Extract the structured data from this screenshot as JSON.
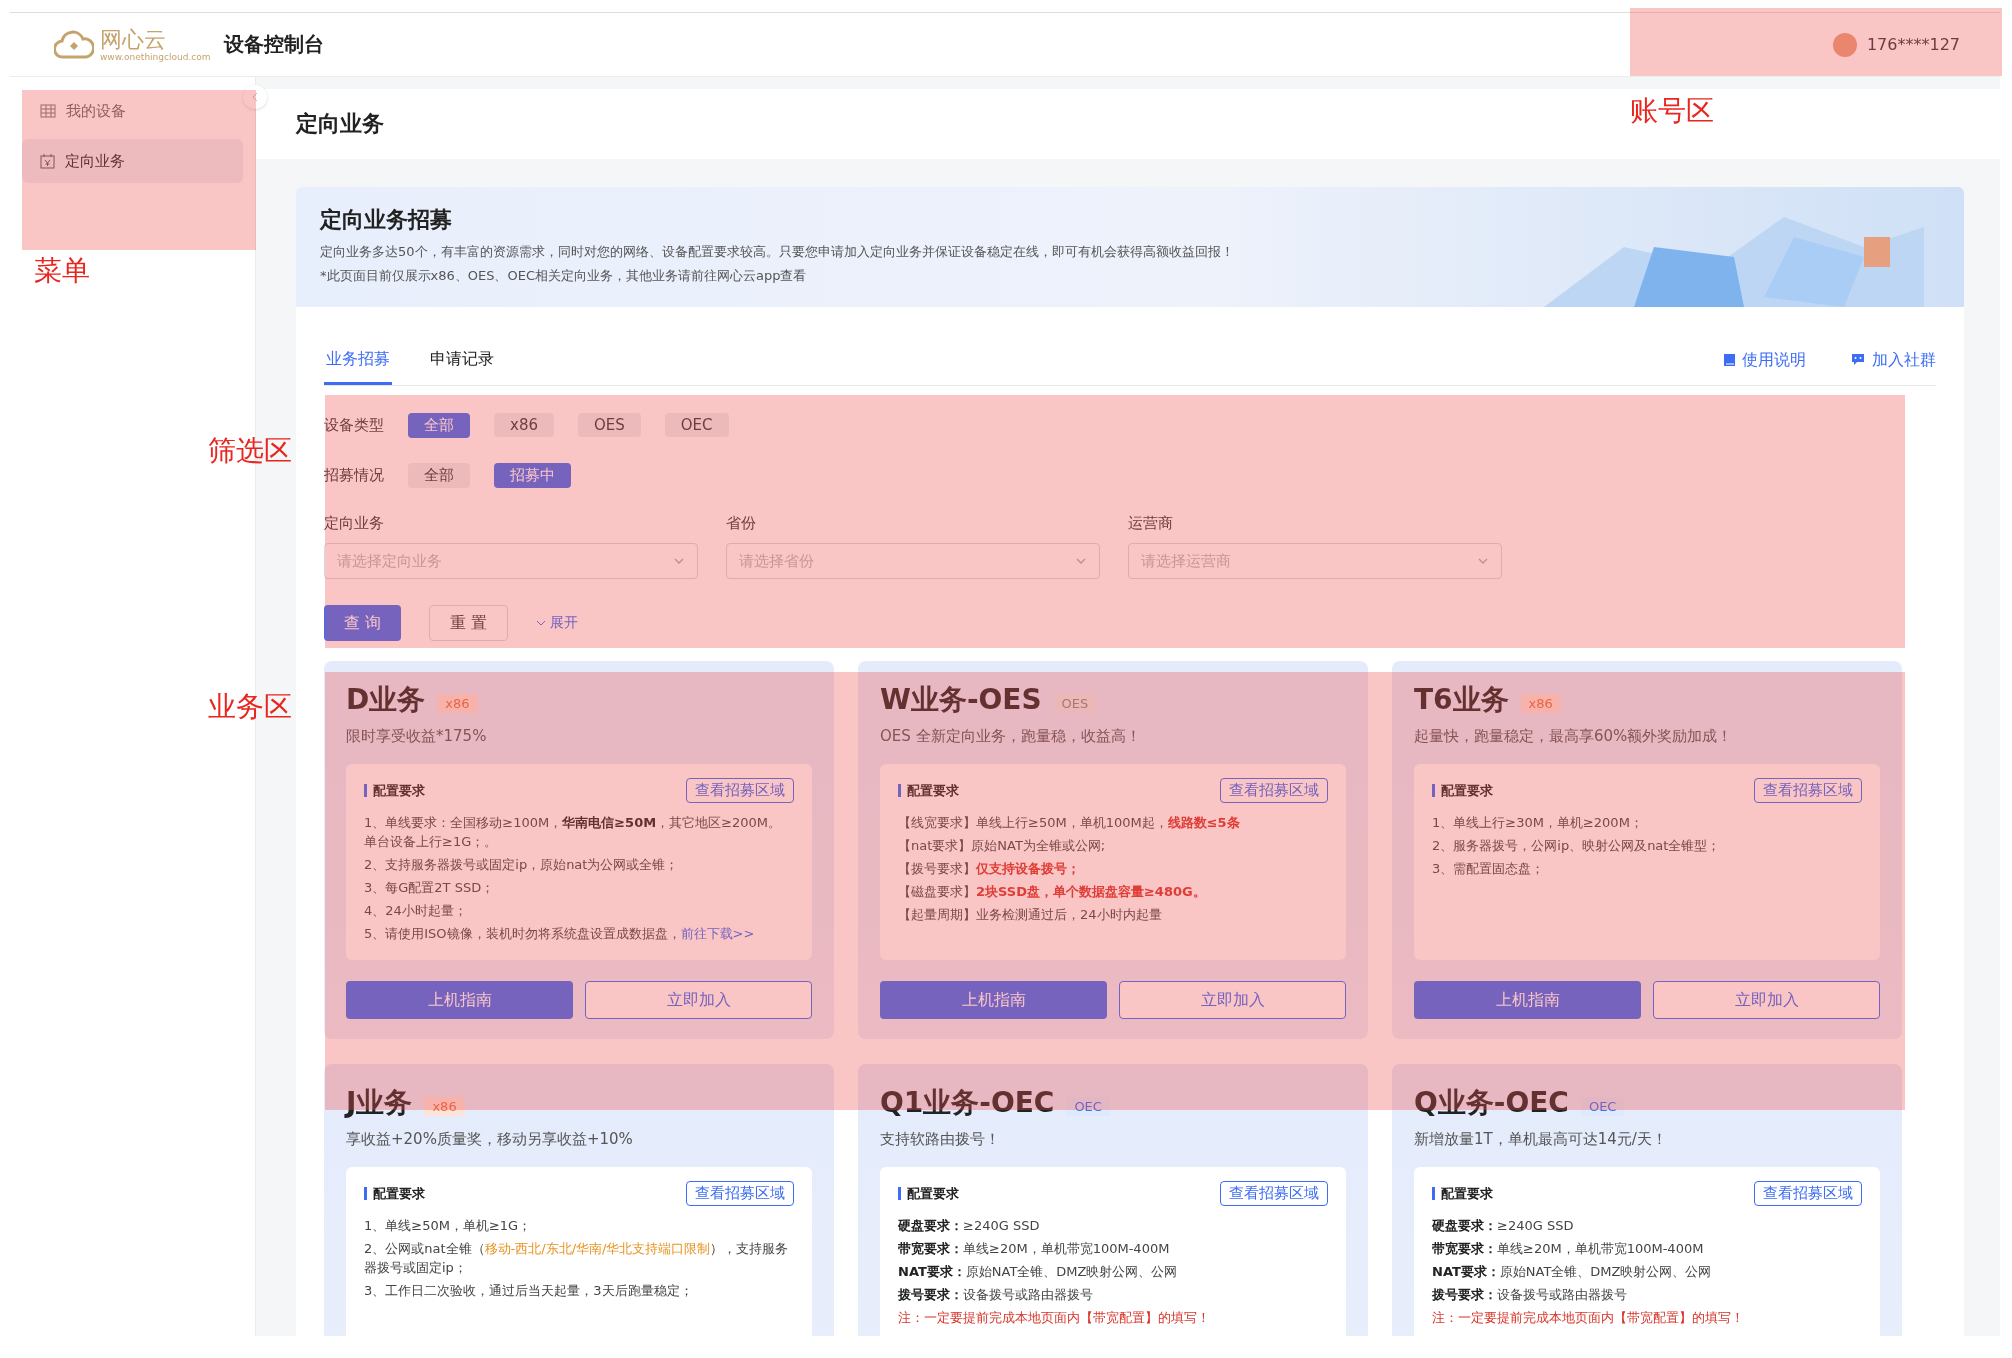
{
  "header": {
    "logo_text": "网心云",
    "logo_sub": "www.onethingcloud.com",
    "title": "设备控制台",
    "account": "176****127"
  },
  "sidebar": {
    "items": [
      {
        "label": "我的设备",
        "selected": false
      },
      {
        "label": "定向业务",
        "selected": true
      }
    ]
  },
  "page_title": "定向业务",
  "banner": {
    "title": "定向业务招募",
    "lines": [
      "定向业务多达50个，有丰富的资源需求，同时对您的网络、设备配置要求较高。只要您申请加入定向业务并保证设备稳定在线，即可有机会获得高额收益回报！",
      "*此页面目前仅展示x86、OES、OEC相关定向业务，其他业务请前往网心云app查看"
    ]
  },
  "tabs": [
    {
      "label": "业务招募",
      "selected": true
    },
    {
      "label": "申请记录",
      "selected": false
    }
  ],
  "tab_links": [
    "使用说明",
    "加入社群"
  ],
  "filters": {
    "chip_rows": [
      {
        "label": "设备类型",
        "options": [
          {
            "label": "全部",
            "selected": true
          },
          {
            "label": "x86",
            "selected": false
          },
          {
            "label": "OES",
            "selected": false
          },
          {
            "label": "OEC",
            "selected": false
          }
        ]
      },
      {
        "label": "招募情况",
        "options": [
          {
            "label": "全部",
            "selected": false
          },
          {
            "label": "招募中",
            "selected": true
          }
        ]
      }
    ],
    "selects": [
      {
        "label": "定向业务",
        "placeholder": "请选择定向业务"
      },
      {
        "label": "省份",
        "placeholder": "请选择省份"
      },
      {
        "label": "运营商",
        "placeholder": "请选择运营商"
      }
    ],
    "query": "查 询",
    "reset": "重 置",
    "expand": "展开"
  },
  "cards": [
    {
      "title": "D业务",
      "tag": "x86",
      "kind": "x86",
      "subtitle": "限时享受收益*175%",
      "section": "配置要求",
      "region_button": "查看招募区域",
      "lines": [
        [
          {
            "text": "1、单线要求：全国移动≥100M，",
            "kind": "plain"
          },
          {
            "text": "华南电信≥50M",
            "kind": "bold"
          },
          {
            "text": "，其它地区≥200M。单台设备上行≥1G；。",
            "kind": "plain"
          }
        ],
        [
          {
            "text": "2、支持服务器拨号或固定ip，原始nat为公网或全锥；",
            "kind": "plain"
          }
        ],
        [
          {
            "text": "3、每G配置2T SSD；",
            "kind": "plain"
          }
        ],
        [
          {
            "text": "4、24小时起量；",
            "kind": "plain"
          }
        ],
        [
          {
            "text": "5、请使用ISO镜像，装机时勿将系统盘设置成数据盘，",
            "kind": "plain"
          },
          {
            "text": "前往下载>>",
            "kind": "link"
          }
        ]
      ],
      "buttons": [
        "上机指南",
        "立即加入"
      ]
    },
    {
      "title": "W业务-OES",
      "tag": "OES",
      "kind": "oes",
      "subtitle": "OES 全新定向业务，跑量稳，收益高！",
      "section": "配置要求",
      "region_button": "查看招募区域",
      "lines": [
        [
          {
            "text": "【线宽要求】单线上行≥50M，单机100M起，",
            "kind": "plain"
          },
          {
            "text": "线路数≤5条",
            "kind": "alert"
          }
        ],
        [
          {
            "text": "【nat要求】原始NAT为全锥或公网;",
            "kind": "plain"
          }
        ],
        [
          {
            "text": "【拨号要求】",
            "kind": "plain"
          },
          {
            "text": "仅支持设备拨号；",
            "kind": "alert"
          }
        ],
        [
          {
            "text": "【磁盘要求】",
            "kind": "plain"
          },
          {
            "text": "2块SSD盘，单个数据盘容量≥480G。",
            "kind": "alert"
          }
        ],
        [
          {
            "text": "【起量周期】业务检测通过后，24小时内起量",
            "kind": "plain"
          }
        ]
      ],
      "buttons": [
        "上机指南",
        "立即加入"
      ]
    },
    {
      "title": "T6业务",
      "tag": "x86",
      "kind": "x86",
      "subtitle": "起量快，跑量稳定，最高享60%额外奖励加成！",
      "section": "配置要求",
      "region_button": "查看招募区域",
      "lines": [
        [
          {
            "text": "1、单线上行≥30M，单机≥200M；",
            "kind": "plain"
          }
        ],
        [
          {
            "text": "2、服务器拨号，公网ip、映射公网及nat全锥型；",
            "kind": "plain"
          }
        ],
        [
          {
            "text": "3、需配置固态盘；",
            "kind": "plain"
          }
        ]
      ],
      "buttons": [
        "上机指南",
        "立即加入"
      ]
    },
    {
      "title": "J业务",
      "tag": "x86",
      "kind": "x86",
      "subtitle": "享收益+20%质量奖，移动另享收益+10%",
      "section": "配置要求",
      "region_button": "查看招募区域",
      "lines": [
        [
          {
            "text": "1、单线≥50M，单机≥1G；",
            "kind": "plain"
          }
        ],
        [
          {
            "text": "2、公网或nat全锥（",
            "kind": "plain"
          },
          {
            "text": "移动-西北/东北/华南/华北支持端口限制",
            "kind": "accent"
          },
          {
            "text": "），支持服务器拨号或固定ip；",
            "kind": "plain"
          }
        ],
        [
          {
            "text": "3、工作日二次验收，通过后当天起量，3天后跑量稳定；",
            "kind": "plain"
          }
        ]
      ]
    },
    {
      "title": "Q1业务-OEC",
      "tag": "OEC",
      "kind": "oec",
      "subtitle": "支持软路由拨号！",
      "section": "配置要求",
      "region_button": "查看招募区域",
      "lines": [
        [
          {
            "text": "硬盘要求：",
            "kind": "bold"
          },
          {
            "text": "≥240G SSD",
            "kind": "plain"
          }
        ],
        [
          {
            "text": "带宽要求：",
            "kind": "bold"
          },
          {
            "text": "单线≥20M，单机带宽100M-400M",
            "kind": "plain"
          }
        ],
        [
          {
            "text": "NAT要求：",
            "kind": "bold"
          },
          {
            "text": "原始NAT全锥、DMZ映射公网、公网",
            "kind": "plain"
          }
        ],
        [
          {
            "text": "拨号要求：",
            "kind": "bold"
          },
          {
            "text": "设备拨号或路由器拨号",
            "kind": "plain"
          }
        ],
        [
          {
            "text": "注：一定要提前完成本地页面内【带宽配置】的填写！",
            "kind": "warn"
          }
        ]
      ]
    },
    {
      "title": "Q业务-OEC",
      "tag": "OEC",
      "kind": "oec",
      "subtitle": "新增放量1T，单机最高可达14元/天！",
      "section": "配置要求",
      "region_button": "查看招募区域",
      "lines": [
        [
          {
            "text": "硬盘要求：",
            "kind": "bold"
          },
          {
            "text": "≥240G SSD",
            "kind": "plain"
          }
        ],
        [
          {
            "text": "带宽要求：",
            "kind": "bold"
          },
          {
            "text": "单线≥20M，单机带宽100M-400M",
            "kind": "plain"
          }
        ],
        [
          {
            "text": "NAT要求：",
            "kind": "bold"
          },
          {
            "text": "原始NAT全锥、DMZ映射公网、公网",
            "kind": "plain"
          }
        ],
        [
          {
            "text": "拨号要求：",
            "kind": "bold"
          },
          {
            "text": "设备拨号或路由器拨号",
            "kind": "plain"
          }
        ],
        [
          {
            "text": "注：一定要提前完成本地页面内【带宽配置】的填写！",
            "kind": "warn"
          }
        ]
      ]
    }
  ],
  "annotations": [
    "账号区",
    "菜单",
    "筛选区",
    "业务区"
  ]
}
